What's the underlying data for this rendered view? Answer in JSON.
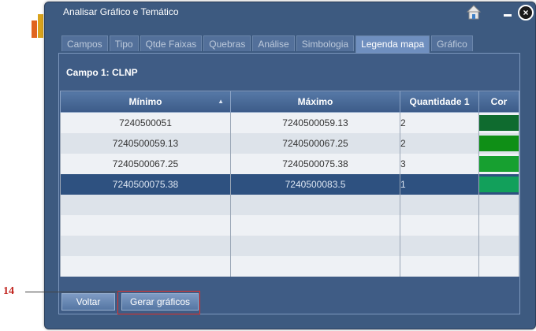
{
  "window": {
    "title": "Analisar Gráfico e Temático"
  },
  "tabs": [
    {
      "label": "Campos",
      "active": false
    },
    {
      "label": "Tipo",
      "active": false
    },
    {
      "label": "Qtde Faixas",
      "active": false
    },
    {
      "label": "Quebras",
      "active": false
    },
    {
      "label": "Análise",
      "active": false
    },
    {
      "label": "Simbologia",
      "active": false
    },
    {
      "label": "Legenda mapa",
      "active": true
    },
    {
      "label": "Gráfico",
      "active": false
    }
  ],
  "campo_label": "Campo 1: CLNP",
  "table": {
    "headers": {
      "min": "Mínimo",
      "max": "Máximo",
      "qty": "Quantidade 1",
      "color": "Cor"
    },
    "sort_indicator": "▲",
    "rows": [
      {
        "min": "7240500051",
        "max": "7240500059.13",
        "qty": "2",
        "color": "#0f6b2f"
      },
      {
        "min": "7240500059.13",
        "max": "7240500067.25",
        "qty": "2",
        "color": "#0f8f16"
      },
      {
        "min": "7240500067.25",
        "max": "7240500075.38",
        "qty": "3",
        "color": "#17a030"
      },
      {
        "min": "7240500075.38",
        "max": "7240500083.5",
        "qty": "1",
        "color": "#12a05b"
      }
    ]
  },
  "buttons": {
    "voltar": "Voltar",
    "gerar": "Gerar gráficos"
  },
  "annotation": {
    "number": "14"
  }
}
